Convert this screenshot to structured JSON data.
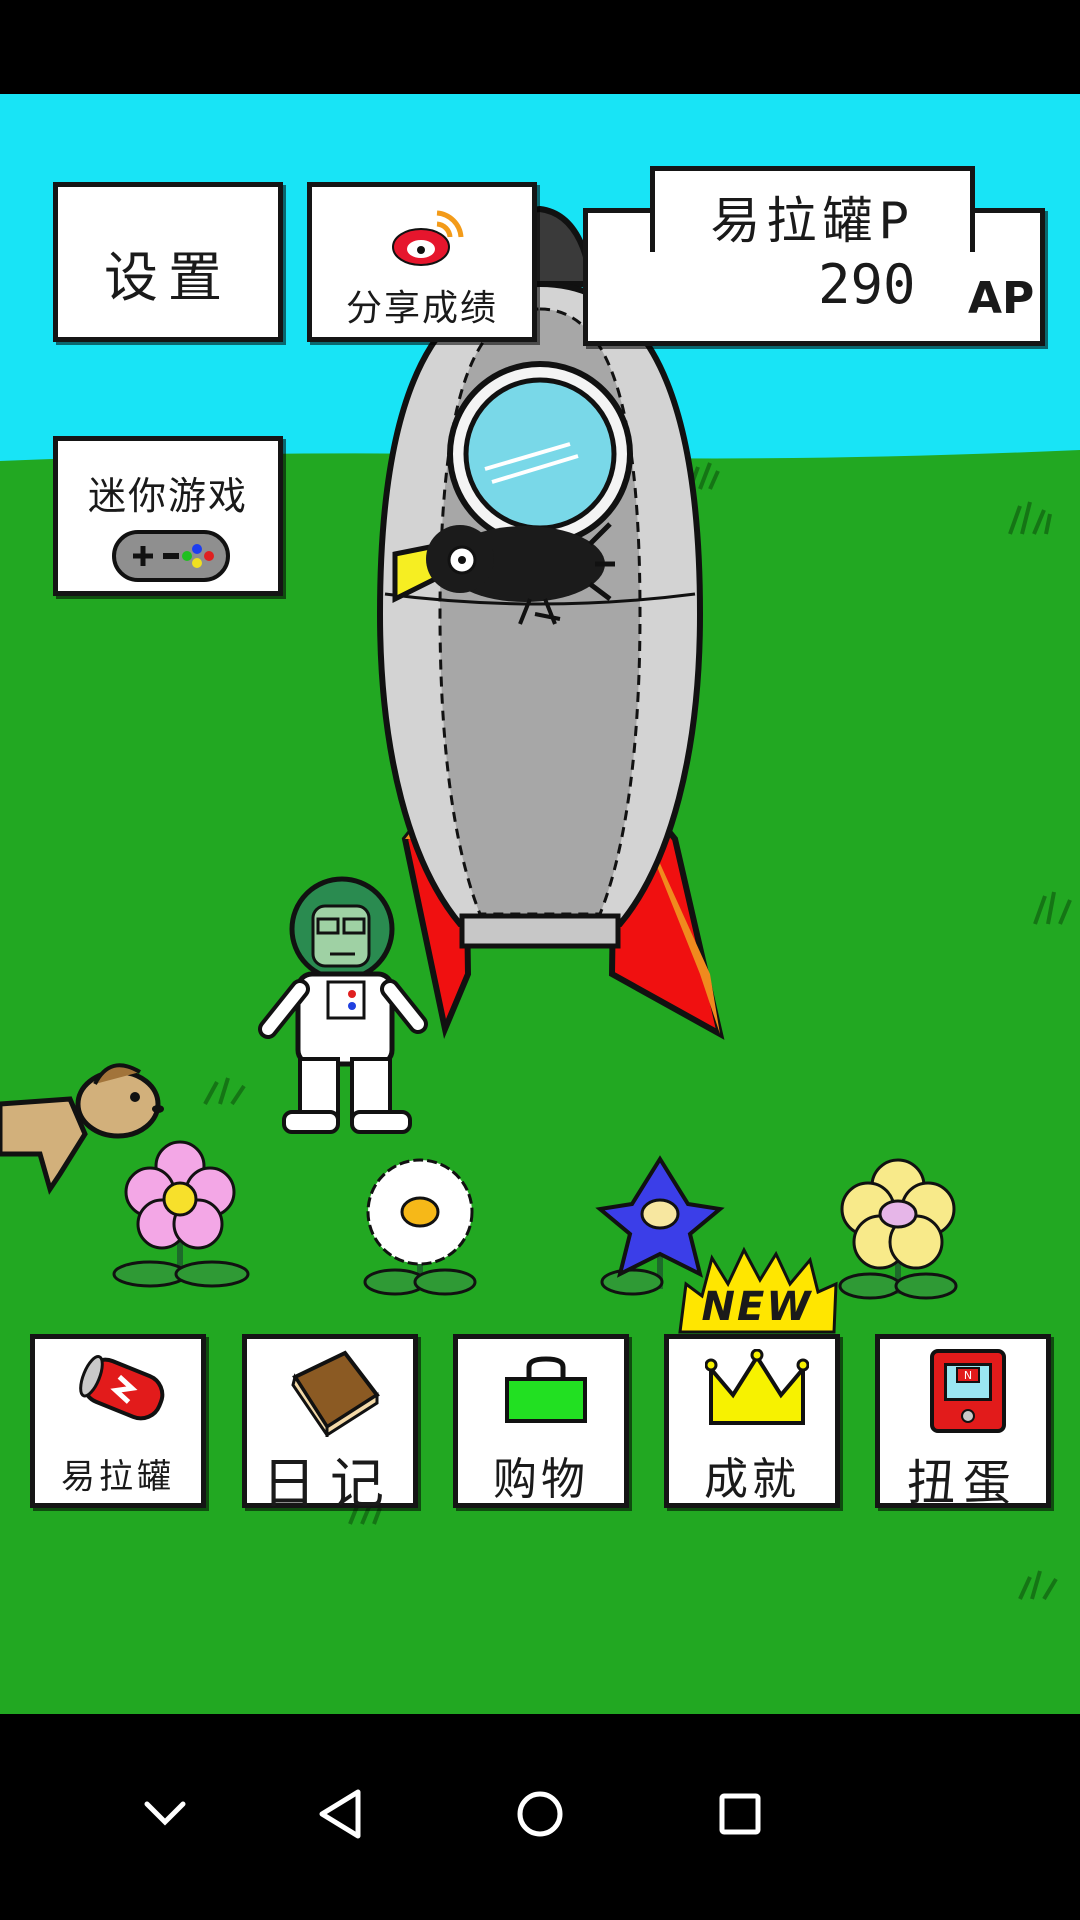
{
  "buttons": {
    "settings": "设置",
    "share": "分享成绩",
    "minigame": "迷你游戏"
  },
  "score": {
    "label": "易拉罐P",
    "value": "290",
    "unit": "AP"
  },
  "menu": {
    "can": "易拉罐",
    "diary": "日记",
    "shop": "购物",
    "achievements": "成就",
    "gacha": "扭蛋",
    "new_badge": "NEW"
  },
  "gacha_icon_text": "N",
  "icons": {
    "share": "weibo-icon",
    "minigame": "gamepad-icon",
    "can": "soda-can-icon",
    "diary": "book-icon",
    "shop": "shopping-bag-icon",
    "achievements": "crown-icon",
    "gacha": "gacha-machine-icon",
    "nav": [
      "chevron-down-icon",
      "back-triangle-icon",
      "home-circle-icon",
      "recents-square-icon"
    ]
  },
  "colors": {
    "sky": "#18e4f6",
    "grass": "#22a822",
    "rocket_fin": "#f01010",
    "crown": "#f7f200",
    "badge": "#ffe600"
  }
}
